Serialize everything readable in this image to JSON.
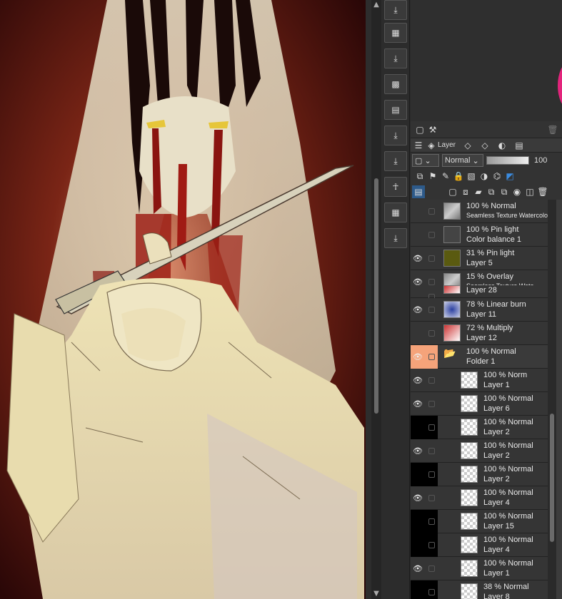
{
  "panel": {
    "tab_label": "Layer",
    "blend_mode": "Normal",
    "opacity": "100"
  },
  "layers": [
    {
      "line1": "100 % Normal",
      "line2": "Seamless Texture Watercolor",
      "visible": false,
      "thumb": "texture"
    },
    {
      "line1": "100 % Pin light",
      "line2": "Color balance 1",
      "visible": false,
      "thumb": "correction"
    },
    {
      "line1": "31 % Pin light",
      "line2": "Layer 5",
      "visible": true,
      "thumb": "olive"
    },
    {
      "line1": "15 % Overlay",
      "line2": "Seamless Texture Wate",
      "visible": true,
      "thumb": "texture"
    },
    {
      "line1": "",
      "line2": "Layer 28",
      "visible": false,
      "thumb": "red"
    },
    {
      "line1": "78 % Linear burn",
      "line2": "Layer 11",
      "visible": true,
      "thumb": "blue"
    },
    {
      "line1": "72 % Multiply",
      "line2": "Layer 12",
      "visible": false,
      "thumb": "red"
    },
    {
      "line1": "100 % Normal",
      "line2": "Folder 1",
      "visible": true,
      "thumb": "folder"
    },
    {
      "line1": "100 % Norm",
      "line2": "Layer 1",
      "visible": true,
      "thumb": "checker"
    },
    {
      "line1": "100 % Normal",
      "line2": "Layer 6",
      "visible": true,
      "thumb": "checker"
    },
    {
      "line1": "100 % Normal",
      "line2": "Layer 2",
      "visible": false,
      "thumb": "checker"
    },
    {
      "line1": "100 % Normal",
      "line2": "Layer 2",
      "visible": true,
      "thumb": "checker"
    },
    {
      "line1": "100 % Normal",
      "line2": "Layer 2",
      "visible": false,
      "thumb": "checker"
    },
    {
      "line1": "100 % Normal",
      "line2": "Layer 4",
      "visible": true,
      "thumb": "checker"
    },
    {
      "line1": "100 % Normal",
      "line2": "Layer 15",
      "visible": false,
      "thumb": "checker"
    },
    {
      "line1": "100 % Normal",
      "line2": "Layer 4",
      "visible": false,
      "thumb": "checker"
    },
    {
      "line1": "100 % Normal",
      "line2": "Layer 1",
      "visible": true,
      "thumb": "checker"
    },
    {
      "line1": "38 % Normal",
      "line2": "Layer 8",
      "visible": false,
      "thumb": "checker"
    }
  ],
  "colors": {
    "accent": "#f5a37a",
    "panel": "#333333",
    "magenta": "#e3247c"
  }
}
